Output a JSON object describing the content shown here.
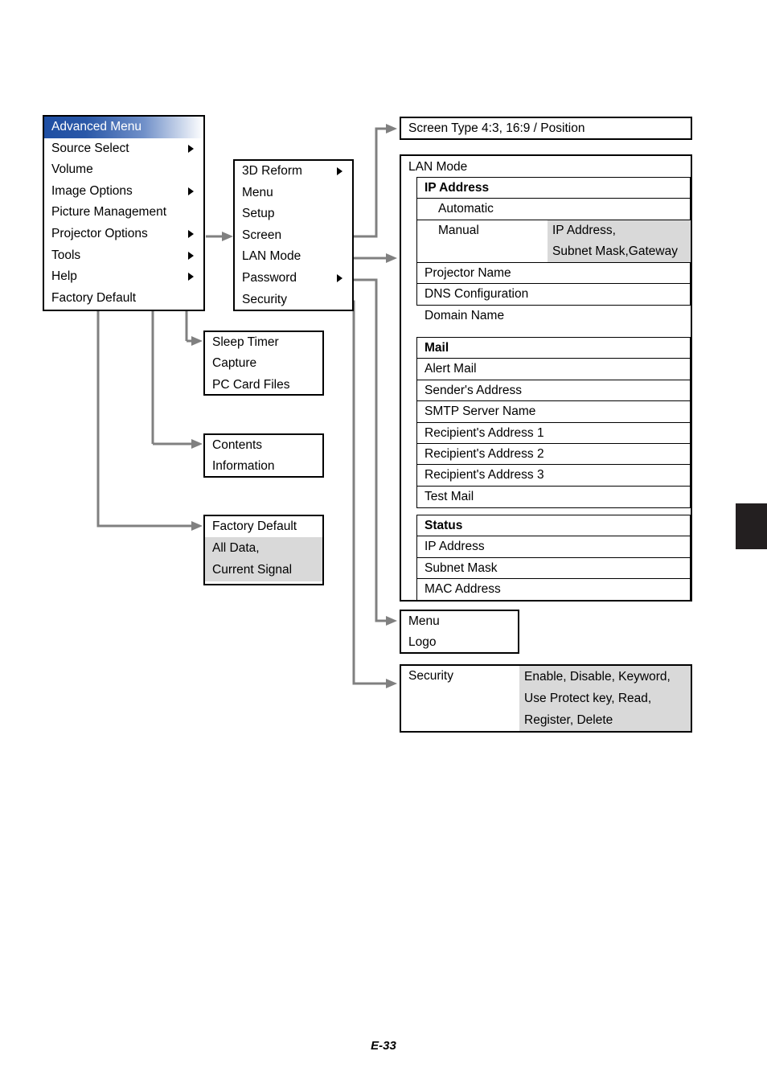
{
  "document": {
    "page_label": "E-33"
  },
  "colors": {
    "highlight_start": "#1f4fa3",
    "shade": "#d9d9d9",
    "connector": "#808080",
    "tab": "#231f20"
  },
  "advanced_menu": {
    "title": "Advanced Menu",
    "items": [
      {
        "label": "Source Select",
        "submenu": true
      },
      {
        "label": "Volume",
        "submenu": false
      },
      {
        "label": "Image Options",
        "submenu": true
      },
      {
        "label": "Picture Management",
        "submenu": false
      },
      {
        "label": "Projector Options",
        "submenu": true
      },
      {
        "label": "Tools",
        "submenu": true
      },
      {
        "label": "Help",
        "submenu": true
      },
      {
        "label": "Factory Default",
        "submenu": false
      }
    ]
  },
  "projector_options_menu": {
    "items": [
      {
        "label": "3D Reform",
        "submenu": true
      },
      {
        "label": "Menu",
        "submenu": false
      },
      {
        "label": "Setup",
        "submenu": false
      },
      {
        "label": "Screen",
        "submenu": false
      },
      {
        "label": "LAN Mode",
        "submenu": false
      },
      {
        "label": "Password",
        "submenu": true
      },
      {
        "label": "Security",
        "submenu": false
      }
    ]
  },
  "screen_type_box": {
    "text": "Screen Type 4:3, 16:9 / Position"
  },
  "lan_mode_panel": {
    "title": "LAN Mode",
    "ip_address": {
      "header": "IP Address",
      "automatic": "Automatic",
      "manual": "Manual",
      "manual_values_line1": "IP Address,",
      "manual_values_line2": "Subnet Mask,Gateway"
    },
    "settings": [
      "Projector Name",
      "DNS Configuration",
      "Domain Name"
    ],
    "mail": {
      "header": "Mail",
      "items": [
        "Alert Mail",
        "Sender's Address",
        "SMTP Server Name",
        "Recipient's Address 1",
        "Recipient's Address 2",
        "Recipient's Address 3",
        "Test Mail"
      ]
    },
    "status": {
      "header": "Status",
      "items": [
        "IP Address",
        "Subnet Mask",
        "MAC Address"
      ]
    }
  },
  "tools_box": {
    "items": [
      "Sleep Timer",
      "Capture",
      "PC Card Files"
    ]
  },
  "help_box": {
    "items": [
      "Contents",
      "Information"
    ]
  },
  "factory_default_box": {
    "title": "Factory Default",
    "value_line1": "All Data,",
    "value_line2": "Current Signal"
  },
  "password_box": {
    "items": [
      "Menu",
      "Logo"
    ]
  },
  "security_box": {
    "label": "Security",
    "value_line1": "Enable, Disable, Keyword,",
    "value_line2": "Use Protect key, Read,",
    "value_line3": "Register, Delete"
  }
}
